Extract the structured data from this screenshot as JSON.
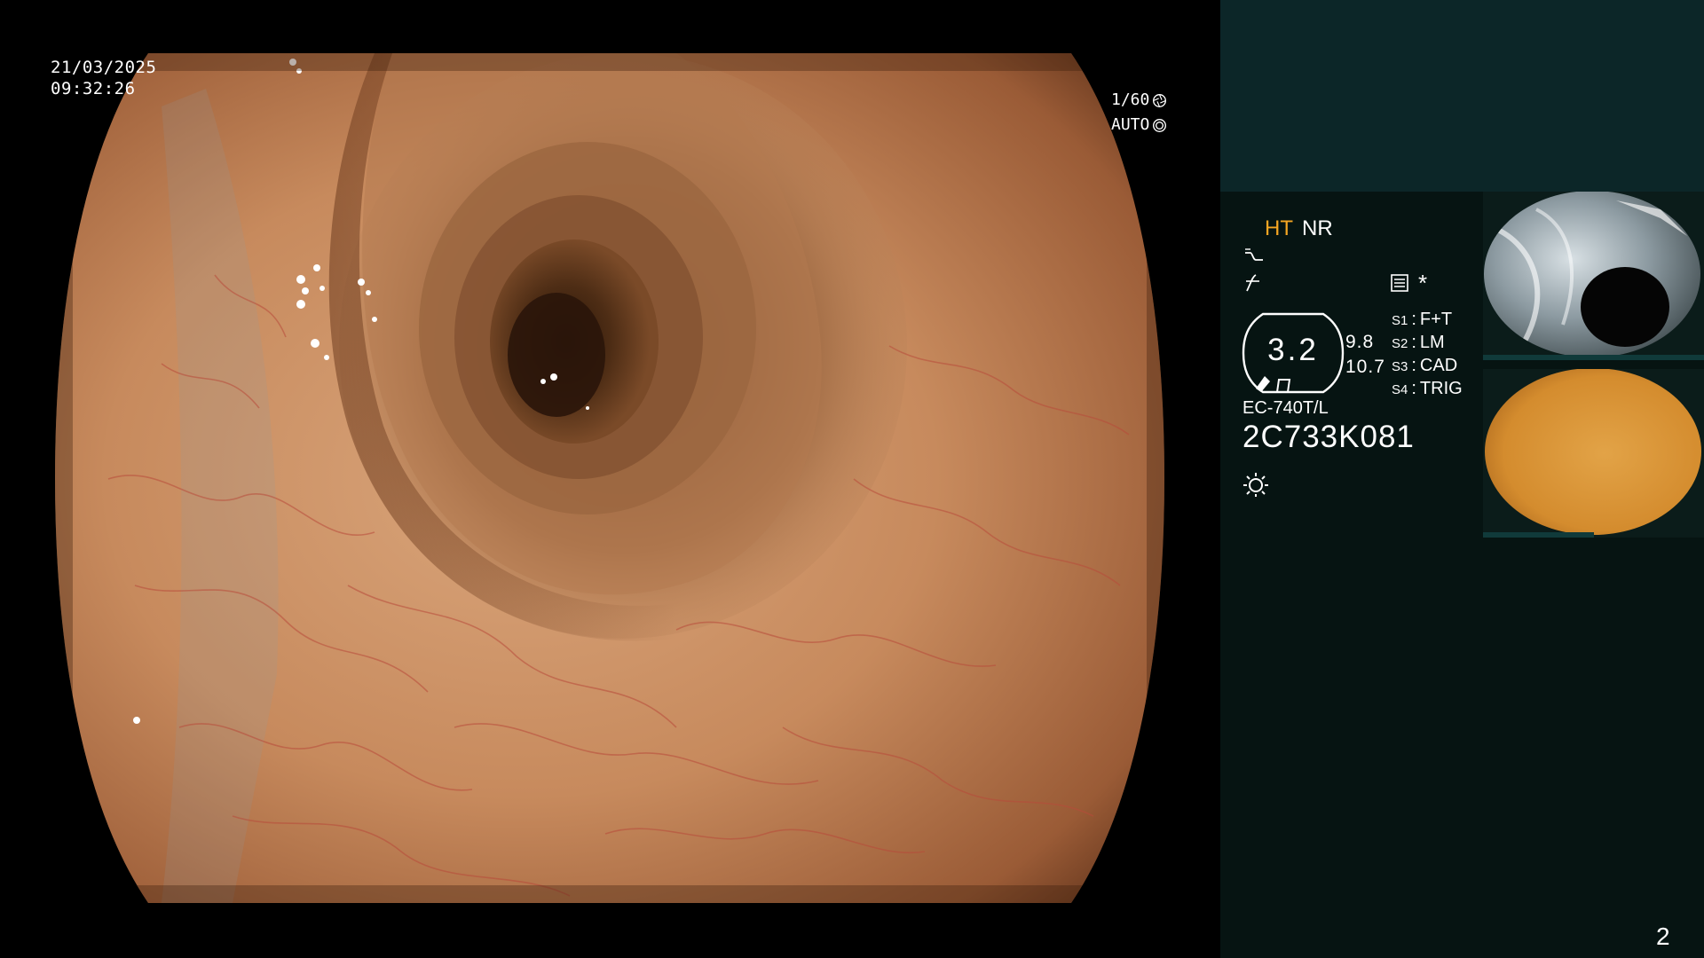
{
  "overlay": {
    "date": "21/03/2025",
    "time": "09:32:26",
    "shutter": "1/60",
    "iris_mode": "AUTO"
  },
  "panel": {
    "mode_ht": "HT",
    "mode_nr": "NR",
    "gauge_value": "3.2",
    "gauge_side_top": "9.8",
    "gauge_side_bottom": "10.7",
    "settings": [
      {
        "key": "S1",
        "value": "F+T"
      },
      {
        "key": "S2",
        "value": "LM"
      },
      {
        "key": "S3",
        "value": "CAD"
      },
      {
        "key": "S4",
        "value": "TRIG"
      }
    ],
    "memo_symbol": "*",
    "scope_model": "EC-740T/L",
    "scope_serial": "2C733K081",
    "page_number": "2"
  },
  "icons": {
    "shutter": "aperture-icon",
    "iris": "iris-icon",
    "curve_1": "tone-curve-icon",
    "curve_2": "contrast-curve-icon",
    "memo": "image-memo-icon",
    "gauge_marks": "scope-tip-icon",
    "light": "light-source-icon"
  },
  "colors": {
    "background": "#000000",
    "panel_top": "#0c2628",
    "panel_bottom": "#061412",
    "mode_ht": "#f5a623",
    "text": "#ffffff"
  }
}
